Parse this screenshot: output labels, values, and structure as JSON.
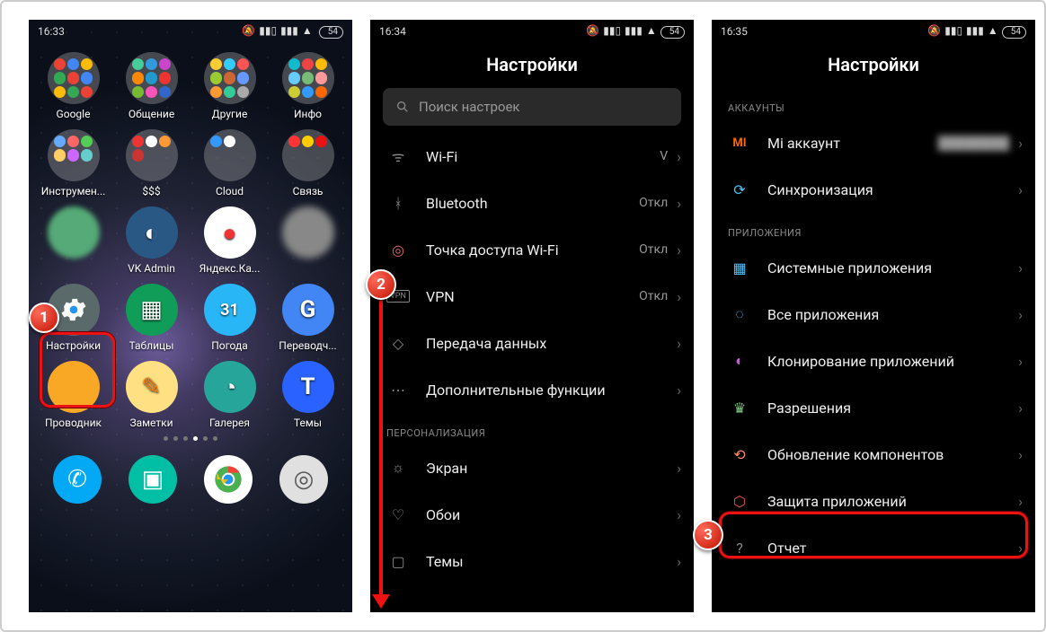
{
  "screens": {
    "home": {
      "time": "16:33",
      "battery": "54",
      "folders": [
        {
          "label": "Google"
        },
        {
          "label": "Общение"
        },
        {
          "label": "Другие"
        },
        {
          "label": "Инфо"
        },
        {
          "label": "Инструмен..."
        },
        {
          "label": "$$$"
        },
        {
          "label": "Cloud"
        },
        {
          "label": "Связь"
        }
      ],
      "apps_row3": [
        {
          "label": ""
        },
        {
          "label": "VK Admin"
        },
        {
          "label": "Яндекс.Ка..."
        },
        {
          "label": ""
        }
      ],
      "apps_row4": [
        {
          "label": "Настройки"
        },
        {
          "label": "Таблицы"
        },
        {
          "label": "Погода"
        },
        {
          "label": "Переводч..."
        }
      ],
      "apps_row5": [
        {
          "label": "Проводник"
        },
        {
          "label": "Заметки"
        },
        {
          "label": "Галерея"
        },
        {
          "label": "Темы"
        }
      ]
    },
    "settings1": {
      "time": "16:34",
      "battery": "54",
      "title": "Настройки",
      "search_placeholder": "Поиск настроек",
      "items": [
        {
          "label": "Wi-Fi",
          "value": "V"
        },
        {
          "label": "Bluetooth",
          "value": "Откл"
        },
        {
          "label": "Точка доступа Wi-Fi",
          "value": "Откл"
        },
        {
          "label": "VPN",
          "value": "Откл"
        },
        {
          "label": "Передача данных",
          "value": ""
        },
        {
          "label": "Дополнительные функции",
          "value": ""
        }
      ],
      "section_personalization": "ПЕРСОНАЛИЗАЦИЯ",
      "items2": [
        {
          "label": "Экран",
          "value": ""
        },
        {
          "label": "Обои",
          "value": ""
        },
        {
          "label": "Темы",
          "value": ""
        }
      ]
    },
    "settings2": {
      "time": "16:35",
      "battery": "54",
      "title": "Настройки",
      "section_accounts": "АККАУНТЫ",
      "acct_items": [
        {
          "label": "Mi аккаунт",
          "value": "████████"
        },
        {
          "label": "Синхронизация",
          "value": ""
        }
      ],
      "section_apps": "ПРИЛОЖЕНИЯ",
      "app_items": [
        {
          "label": "Системные приложения"
        },
        {
          "label": "Все приложения"
        },
        {
          "label": "Клонирование приложений"
        },
        {
          "label": "Разрешения"
        },
        {
          "label": "Обновление компонентов"
        },
        {
          "label": "Защита приложений"
        },
        {
          "label": "Отчет"
        }
      ]
    }
  },
  "annotations": {
    "b1": "1",
    "b2": "2",
    "b3": "3"
  }
}
